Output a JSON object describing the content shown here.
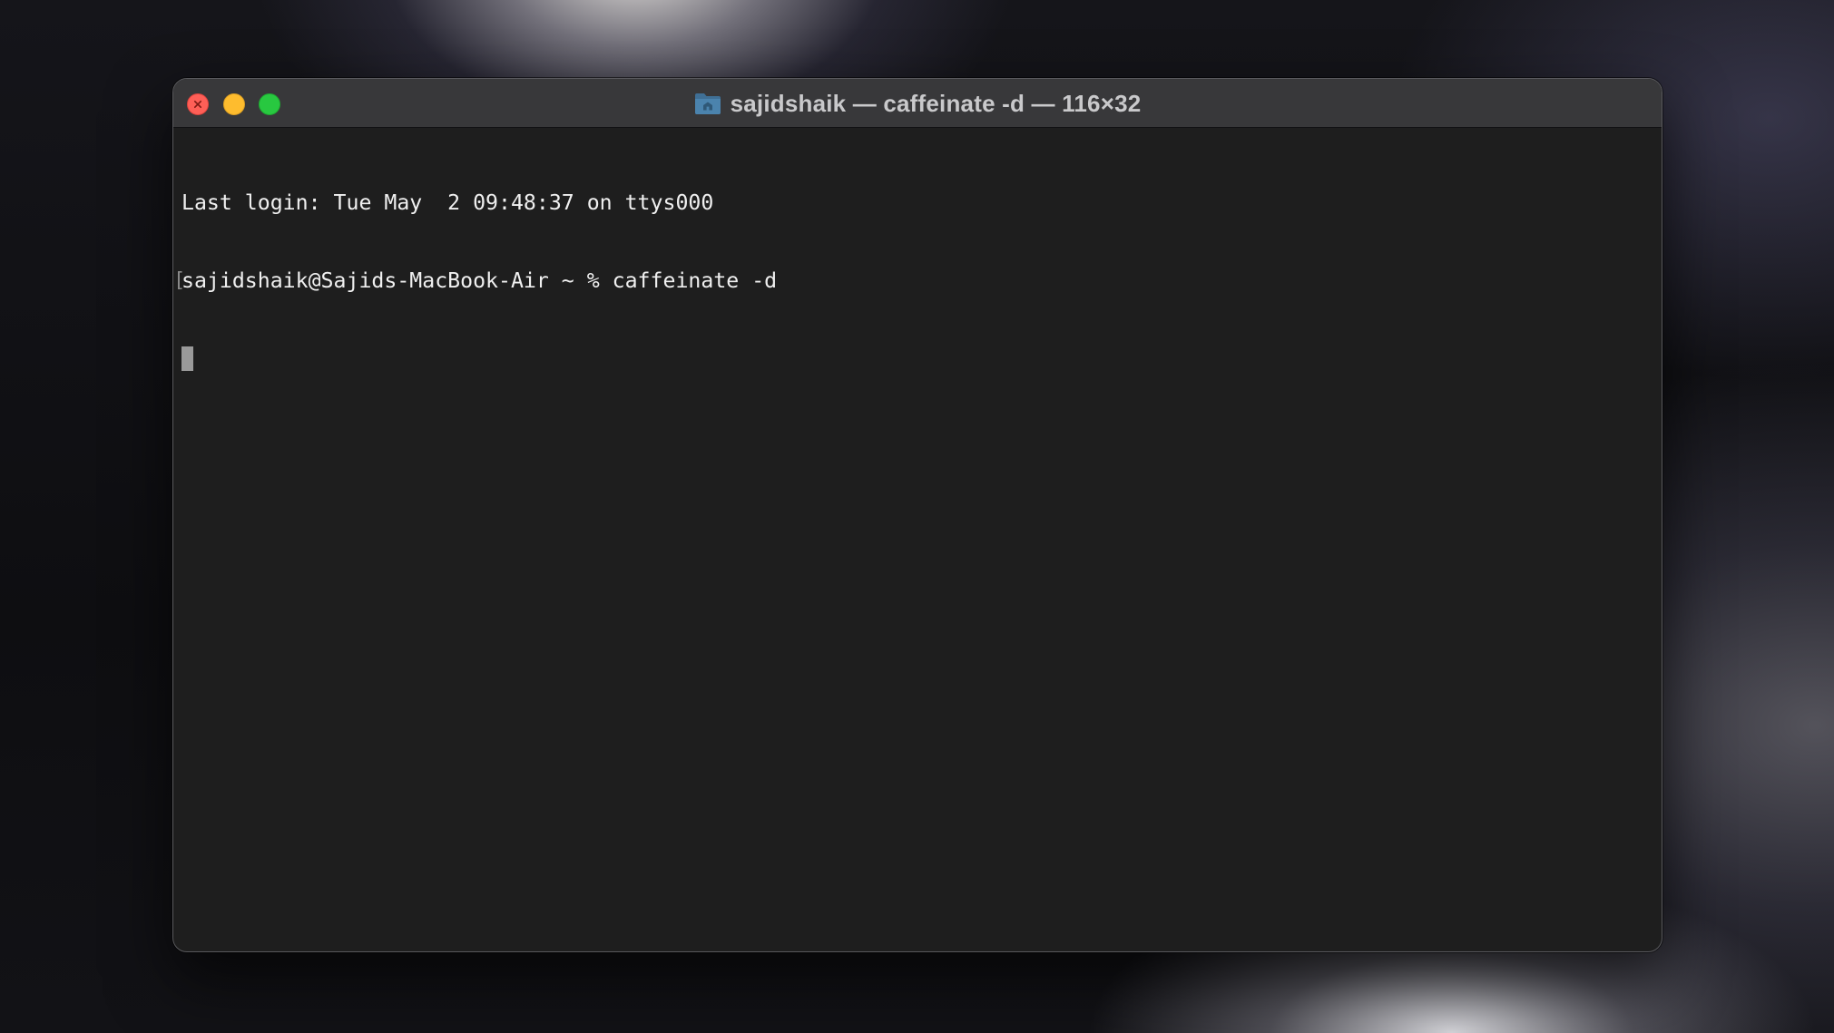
{
  "window": {
    "title": "sajidshaik — caffeinate -d — 116×32",
    "folder_icon": "folder-icon"
  },
  "traffic_lights": {
    "close_color": "#fe5f57",
    "minimize_color": "#febc2e",
    "zoom_color": "#28c840"
  },
  "terminal": {
    "lines": [
      "Last login: Tue May  2 09:48:37 on ttys000",
      "sajidshaik@Sajids-MacBook-Air ~ % caffeinate -d"
    ],
    "mark_left": "[",
    "mark_right": "]",
    "background": "#1e1e1e",
    "foreground": "#f0f0f0"
  }
}
